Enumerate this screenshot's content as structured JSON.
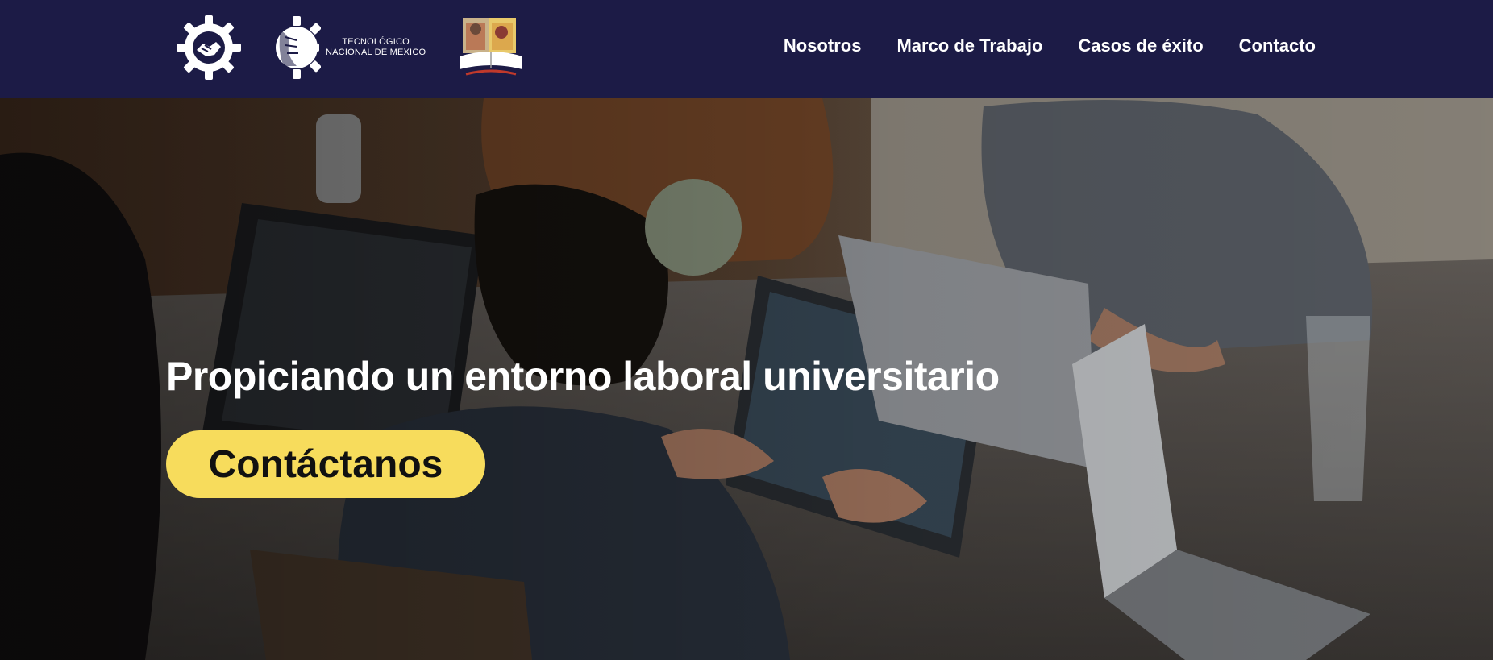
{
  "header": {
    "logos": [
      {
        "icon": "gear-handshake-logo-icon"
      },
      {
        "icon": "tecnm-logo-icon",
        "text_line1": "TECNOLÓGICO",
        "text_line2": "NACIONAL DE MEXICO"
      },
      {
        "icon": "institute-crest-logo-icon"
      }
    ],
    "nav": [
      {
        "label": "Nosotros"
      },
      {
        "label": "Marco de Trabajo"
      },
      {
        "label": "Casos de éxito"
      },
      {
        "label": "Contacto"
      }
    ]
  },
  "hero": {
    "background": "photo-people-working-laptops",
    "title": "Propiciando un entorno laboral universitario",
    "cta_label": "Contáctanos"
  },
  "colors": {
    "header_bg": "#1c1b46",
    "cta_bg": "#f7dc5c",
    "text_light": "#ffffff"
  }
}
